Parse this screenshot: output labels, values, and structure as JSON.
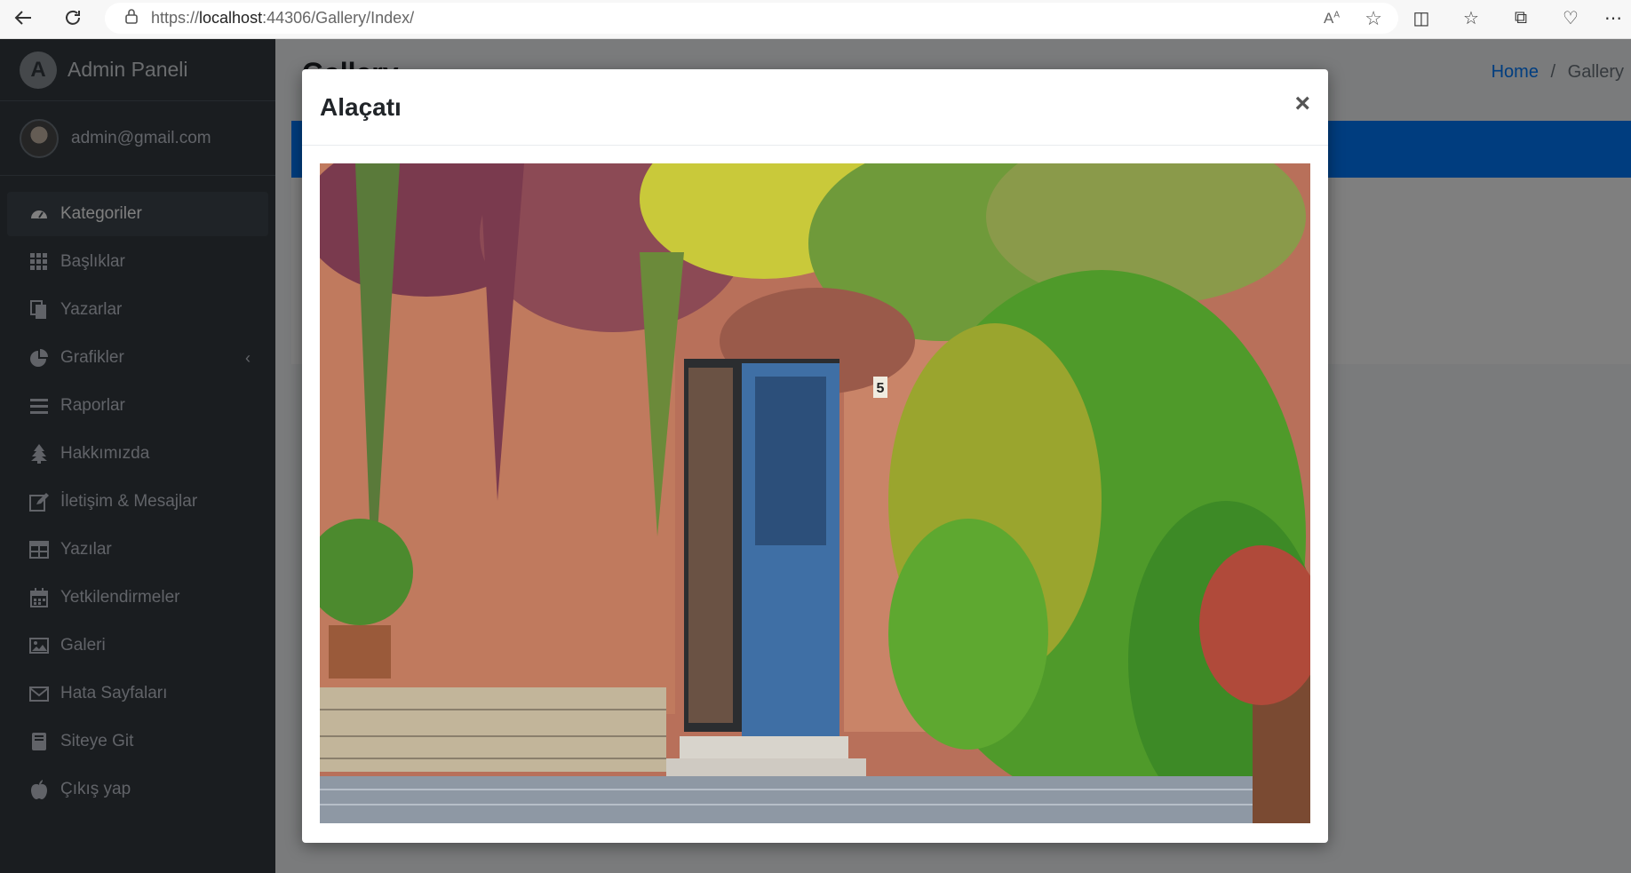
{
  "browser": {
    "url_prefix": "https://",
    "url_host": "localhost",
    "url_rest": ":44306/Gallery/Index/"
  },
  "sidebar": {
    "brand": "Admin Paneli",
    "brand_logo_letter": "A",
    "user": "admin@gmail.com",
    "items": [
      {
        "label": "Kategoriler",
        "icon": "tachometer-icon"
      },
      {
        "label": "Başlıklar",
        "icon": "grid-icon"
      },
      {
        "label": "Yazarlar",
        "icon": "copy-icon"
      },
      {
        "label": "Grafikler",
        "icon": "pie-chart-icon"
      },
      {
        "label": "Raporlar",
        "icon": "bars-icon"
      },
      {
        "label": "Hakkımızda",
        "icon": "tree-icon"
      },
      {
        "label": "İletişim & Mesajlar",
        "icon": "edit-icon"
      },
      {
        "label": "Yazılar",
        "icon": "table-icon"
      },
      {
        "label": "Yetkilendirmeler",
        "icon": "calendar-icon"
      },
      {
        "label": "Galeri",
        "icon": "image-icon"
      },
      {
        "label": "Hata Sayfaları",
        "icon": "envelope-icon"
      },
      {
        "label": "Siteye Git",
        "icon": "book-icon"
      },
      {
        "label": "Çıkış yap",
        "icon": "apple-icon"
      }
    ]
  },
  "main": {
    "page_title": "Gallery",
    "breadcrumb": {
      "home": "Home",
      "separator": "/",
      "current": "Gallery"
    }
  },
  "modal": {
    "title": "Alaçatı",
    "close_label": "×",
    "house_number": "5"
  },
  "colors": {
    "sidebar_bg": "#343a40",
    "accent": "#007bff"
  }
}
